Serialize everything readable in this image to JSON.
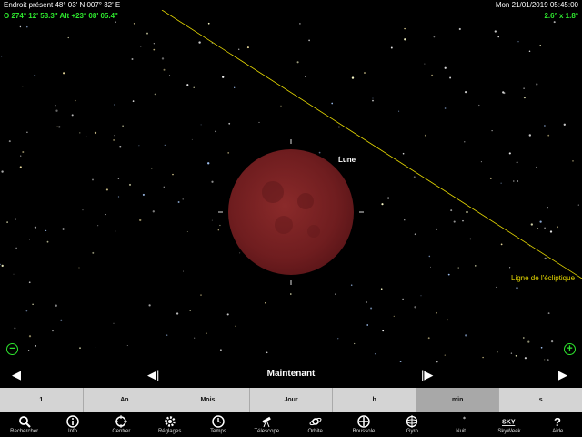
{
  "status": {
    "location": "Endroit présent  48° 03' N 007° 32' E",
    "datetime": "Mon 21/01/2019  05:45:00"
  },
  "coords": "274° 12' 53.3\" Alt +23° 08' 05.4\"",
  "coords_prefix": "O",
  "fov": "2.6° x  1.8°",
  "labels": {
    "moon": "Lune",
    "ecliptic": "Ligne de l'écliptique"
  },
  "zoom": {
    "out": "−",
    "in": "+"
  },
  "timebar": {
    "title": "Maintenant",
    "left": "◀",
    "step_back": "◀|",
    "step_fwd": "|▶",
    "right": "▶"
  },
  "units": [
    "1",
    "An",
    "Mois",
    "Jour",
    "h",
    "min",
    "s"
  ],
  "active_unit": "min",
  "toolbar": [
    {
      "label": "Rechercher",
      "icon": "search-icon"
    },
    {
      "label": "Info",
      "icon": "info-icon"
    },
    {
      "label": "Centrer",
      "icon": "crosshair-icon"
    },
    {
      "label": "Réglages",
      "icon": "gear-icon"
    },
    {
      "label": "Temps",
      "icon": "clock-icon"
    },
    {
      "label": "Télescope",
      "icon": "telescope-icon"
    },
    {
      "label": "Orbite",
      "icon": "orbit-icon"
    },
    {
      "label": "Boussole",
      "icon": "compass-icon"
    },
    {
      "label": "Gyro",
      "icon": "gyro-icon"
    },
    {
      "label": "Nuit",
      "icon": "night-icon"
    },
    {
      "label": "SkyWeek",
      "icon": "skyweek-icon"
    },
    {
      "label": "Aide",
      "icon": "help-icon"
    }
  ],
  "colors": {
    "green": "#2ee62e",
    "ecliptic": "#e6d800",
    "moon": "#7a2020"
  }
}
